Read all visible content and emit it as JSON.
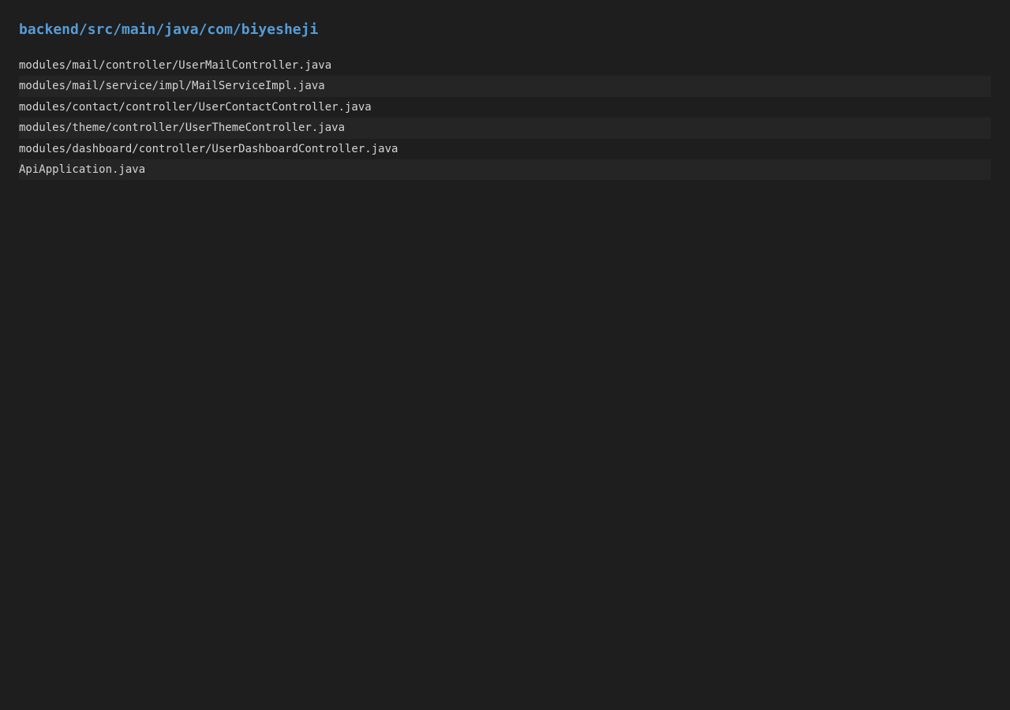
{
  "header": {
    "path": "backend/src/main/java/com/biyesheji"
  },
  "files": [
    "modules/mail/controller/UserMailController.java",
    "modules/mail/service/impl/MailServiceImpl.java",
    "modules/contact/controller/UserContactController.java",
    "modules/theme/controller/UserThemeController.java",
    "modules/dashboard/controller/UserDashboardController.java",
    "ApiApplication.java"
  ],
  "colors": {
    "background": "#1e1e1e",
    "header": "#569cd6",
    "text": "#d4d4d4",
    "stripe": "#252525"
  }
}
